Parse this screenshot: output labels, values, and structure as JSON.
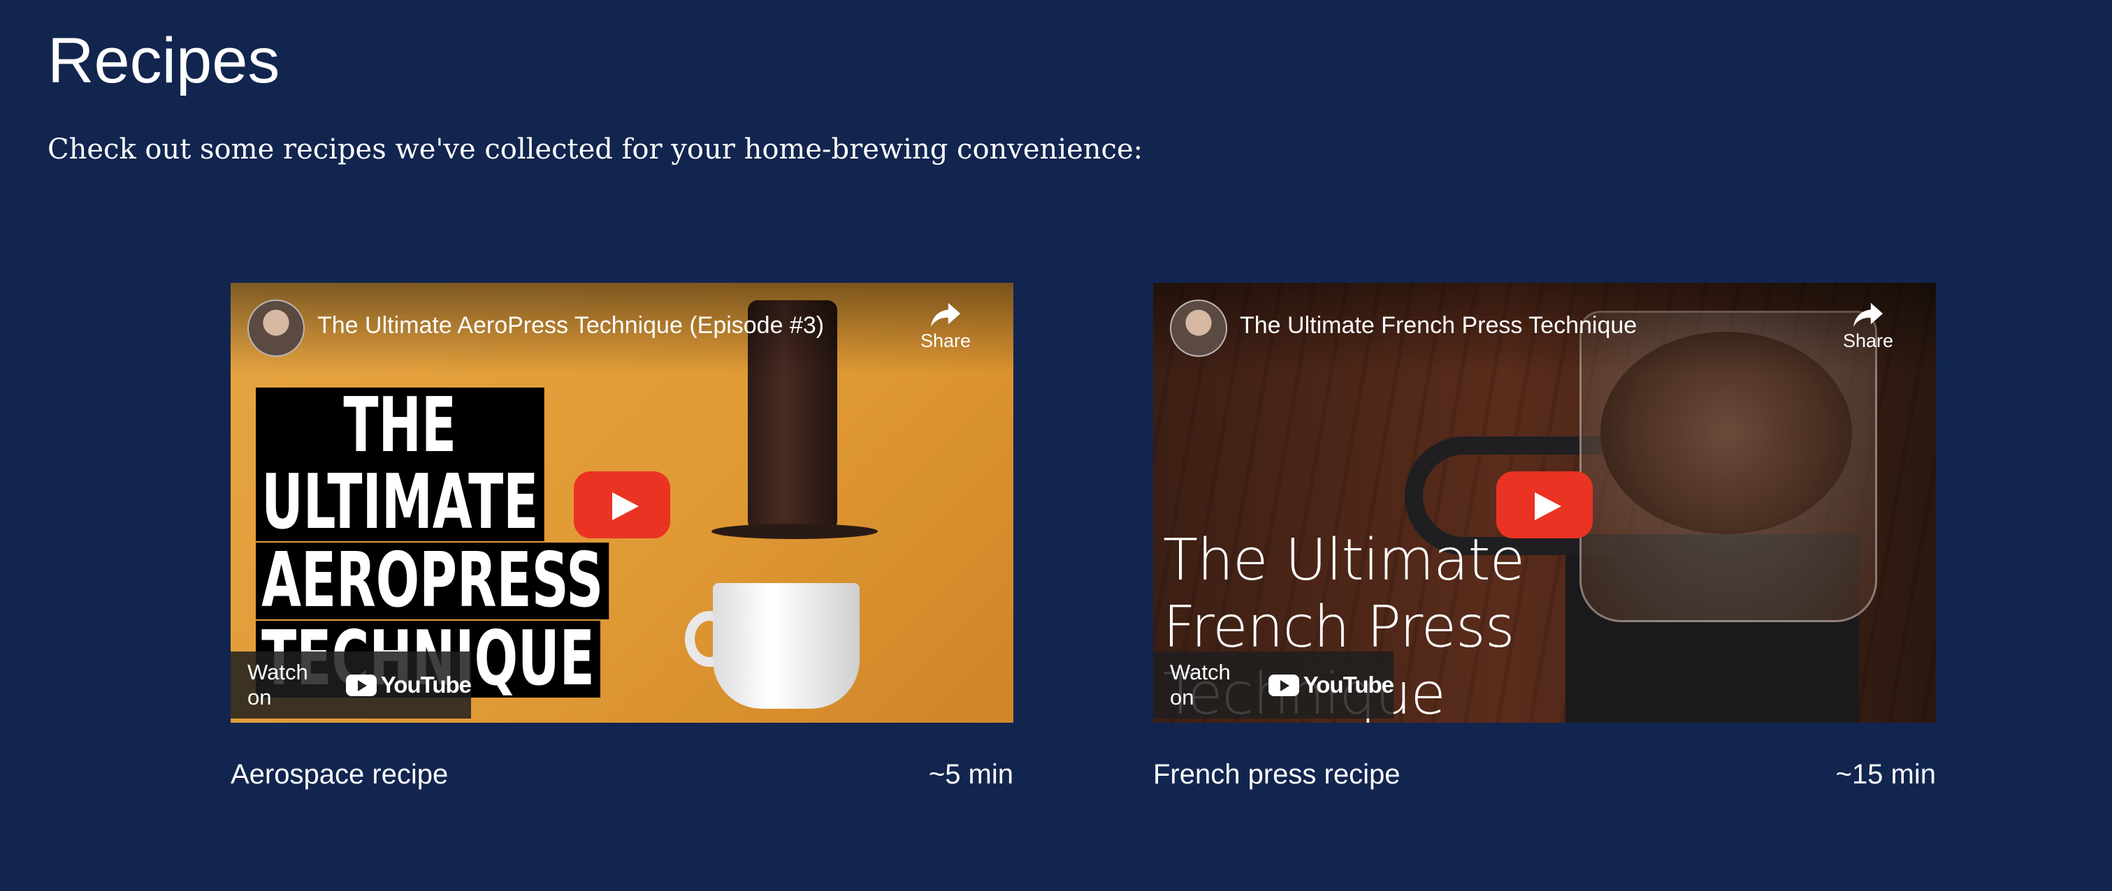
{
  "page": {
    "title": "Recipes",
    "intro": "Check out some recipes we've collected for your home-brewing convenience:"
  },
  "recipes": [
    {
      "video_title": "The Ultimate AeroPress Technique (Episode #3)",
      "share_label": "Share",
      "watch_label": "Watch on",
      "youtube_label": "YouTube",
      "thumbnail_text": [
        "THE ULTIMATE",
        "AEROPRESS",
        "TECHNIQUE"
      ],
      "name": "Aerospace recipe",
      "duration": "~5 min"
    },
    {
      "video_title": "The Ultimate French Press Technique",
      "share_label": "Share",
      "watch_label": "Watch on",
      "youtube_label": "YouTube",
      "thumbnail_text": "The Ultimate\nFrench Press\nTechnique",
      "name": "French press recipe",
      "duration": "~15 min"
    }
  ],
  "colors": {
    "background": "#12254f",
    "play_button": "#ea3323",
    "text": "#ffffff"
  },
  "icons": [
    "share-icon",
    "play-icon",
    "youtube-logo-icon",
    "avatar"
  ]
}
